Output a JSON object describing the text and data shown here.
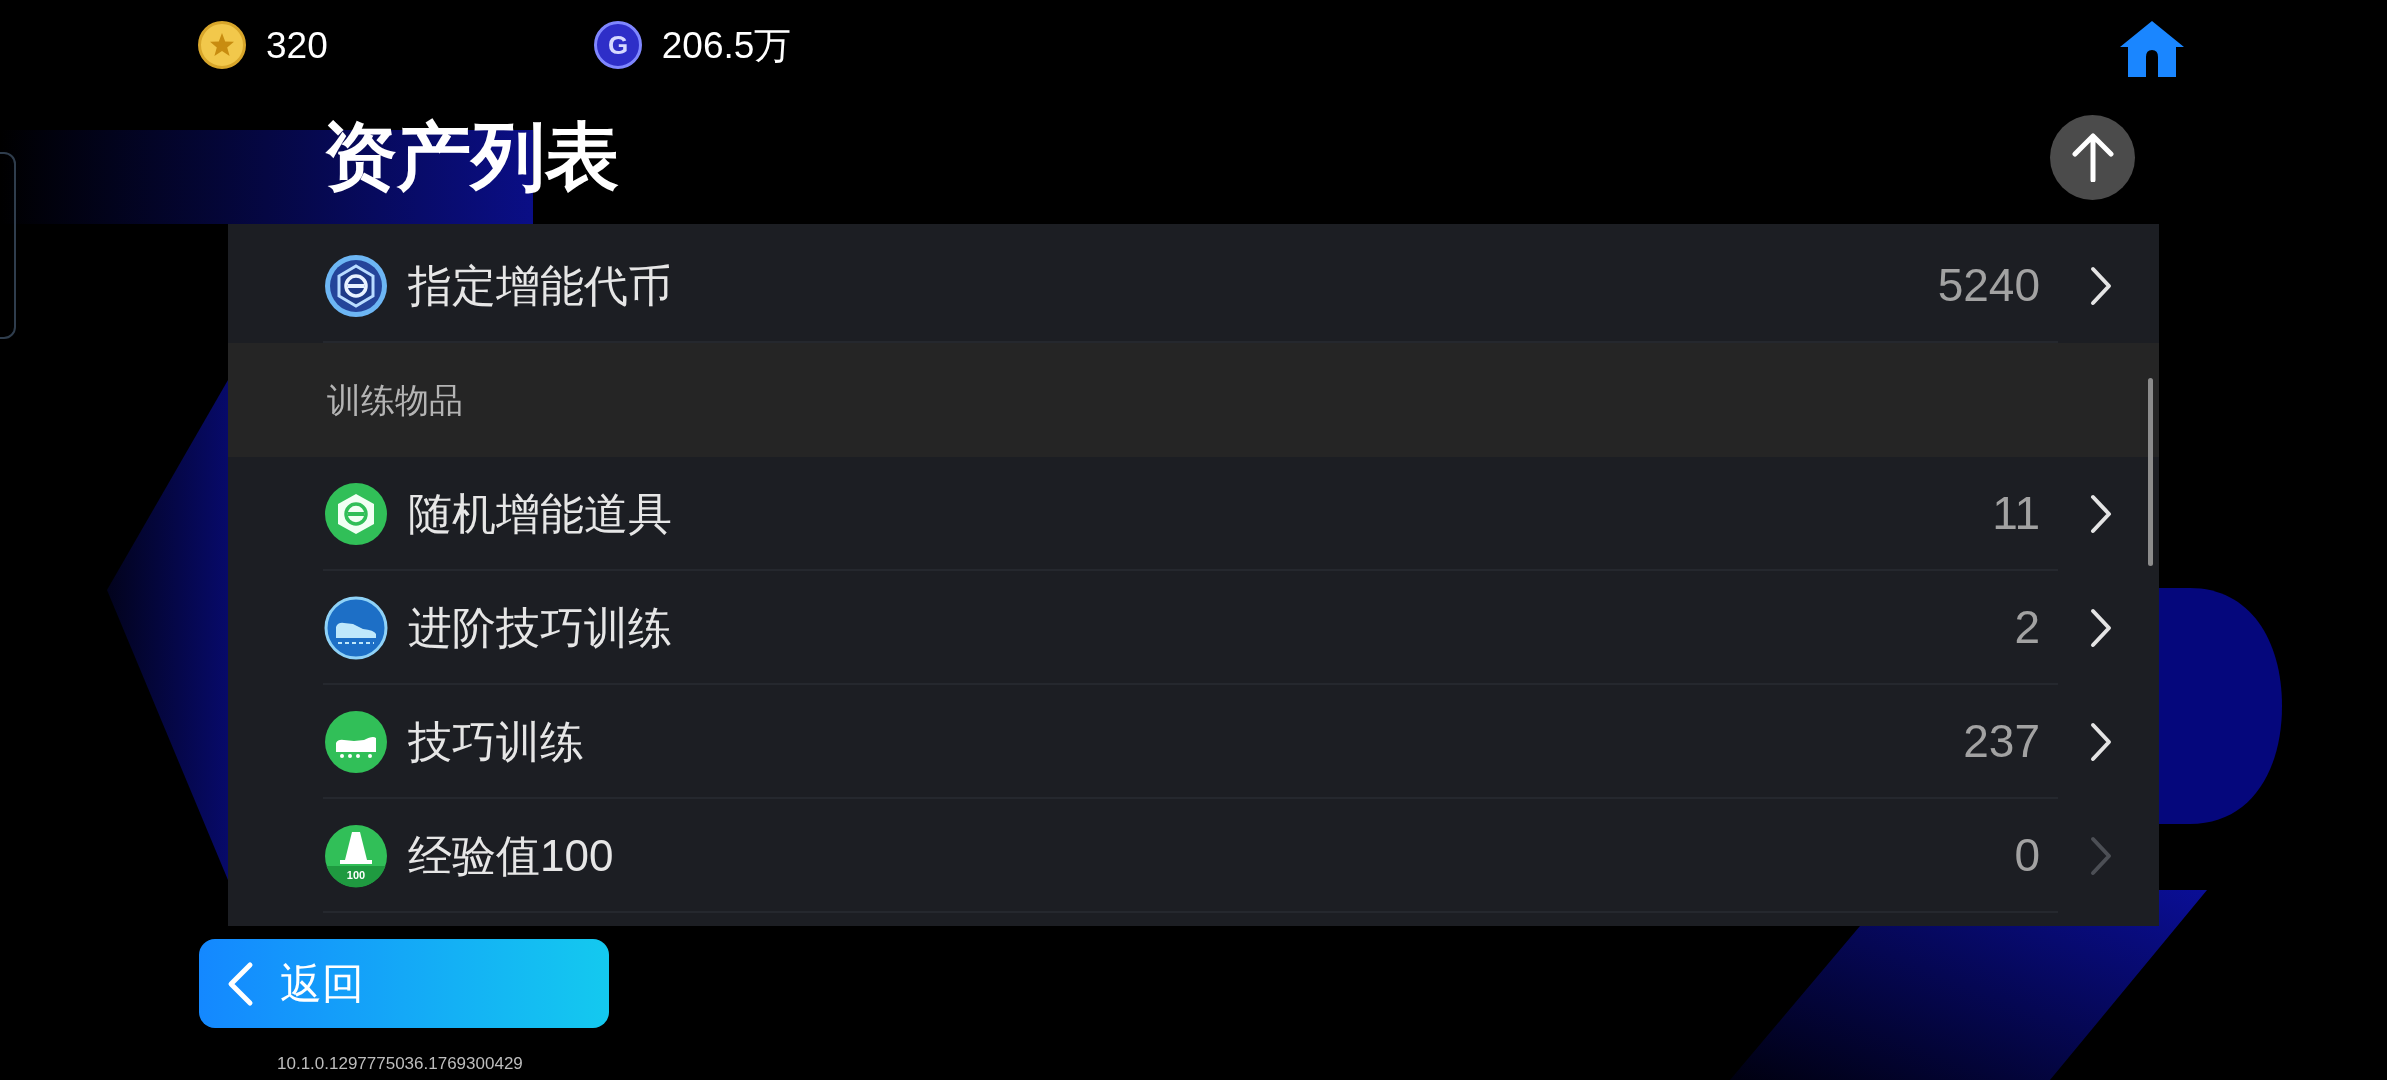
{
  "currencies": [
    {
      "kind": "star",
      "amount": "320"
    },
    {
      "kind": "letter",
      "symbol": "G",
      "amount": "206.5万"
    }
  ],
  "title": "资产列表",
  "asset_list": {
    "sections": [
      {
        "rows": [
          {
            "kind": "token",
            "name": "指定增能代币",
            "count": "5240",
            "disabled": false
          }
        ]
      },
      {
        "heading": "训练物品",
        "rows": [
          {
            "kind": "booster",
            "name": "随机增能道具",
            "count": "11",
            "disabled": false
          },
          {
            "kind": "advanced",
            "name": "进阶技巧训练",
            "count": "2",
            "disabled": false
          },
          {
            "kind": "training",
            "name": "技巧训练",
            "count": "237",
            "disabled": false
          },
          {
            "kind": "experience",
            "badge": "100",
            "name": "经验值100",
            "count": "0",
            "disabled": true
          }
        ]
      }
    ]
  },
  "back_button": {
    "label": "返回"
  },
  "version": "10.1.0.1297775036.1769300429"
}
